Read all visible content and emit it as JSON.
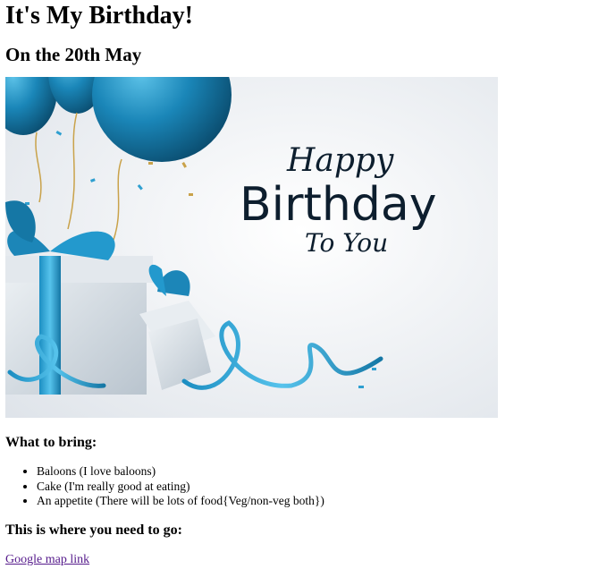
{
  "page": {
    "title": "It's My Birthday!",
    "subtitle": "On the 20th May"
  },
  "banner": {
    "line1": "Happy",
    "line2": "Birthday",
    "line3": "To You",
    "colors": {
      "background": "#eef1f5",
      "balloon": "#1679a8",
      "ribbon": "#2e9fd0",
      "box": "#d5dde4",
      "text": "#0d1e2e"
    }
  },
  "bring": {
    "heading": "What to bring:",
    "items": [
      "Baloons (I love baloons)",
      "Cake (I'm really good at eating)",
      "An appetite (There will be lots of food{Veg/non-veg both})"
    ]
  },
  "location": {
    "heading": "This is where you need to go:",
    "link_text": "Google map link"
  }
}
